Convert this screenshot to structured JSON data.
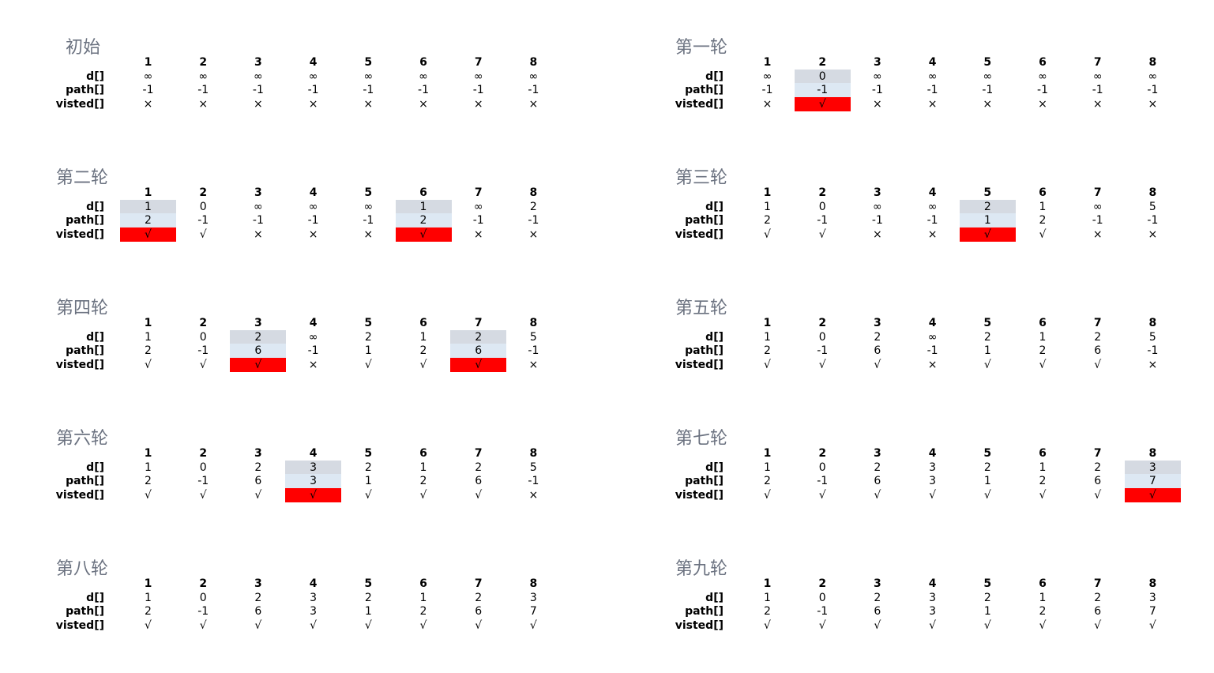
{
  "row_labels": [
    "d[]",
    "path[]",
    "visted[]"
  ],
  "columns": [
    "1",
    "2",
    "3",
    "4",
    "5",
    "6",
    "7",
    "8"
  ],
  "colors": {
    "title": "#6b7280",
    "highlight_d": "#d5dae2",
    "highlight_path": "#dde8f3",
    "highlight_visited": "#ff0000"
  },
  "panels": [
    {
      "title": "初始",
      "d": [
        "∞",
        "∞",
        "∞",
        "∞",
        "∞",
        "∞",
        "∞",
        "∞"
      ],
      "path": [
        "-1",
        "-1",
        "-1",
        "-1",
        "-1",
        "-1",
        "-1",
        "-1"
      ],
      "visited": [
        "×",
        "×",
        "×",
        "×",
        "×",
        "×",
        "×",
        "×"
      ],
      "highlight": []
    },
    {
      "title": "第一轮",
      "d": [
        "∞",
        "0",
        "∞",
        "∞",
        "∞",
        "∞",
        "∞",
        "∞"
      ],
      "path": [
        "-1",
        "-1",
        "-1",
        "-1",
        "-1",
        "-1",
        "-1",
        "-1"
      ],
      "visited": [
        "×",
        "√",
        "×",
        "×",
        "×",
        "×",
        "×",
        "×"
      ],
      "highlight": [
        2
      ]
    },
    {
      "title": "第二轮",
      "d": [
        "1",
        "0",
        "∞",
        "∞",
        "∞",
        "1",
        "∞",
        "2"
      ],
      "path": [
        "2",
        "-1",
        "-1",
        "-1",
        "-1",
        "2",
        "-1",
        "-1"
      ],
      "visited": [
        "√",
        "√",
        "×",
        "×",
        "×",
        "√",
        "×",
        "×"
      ],
      "highlight": [
        1,
        6
      ]
    },
    {
      "title": "第三轮",
      "d": [
        "1",
        "0",
        "∞",
        "∞",
        "2",
        "1",
        "∞",
        "5"
      ],
      "path": [
        "2",
        "-1",
        "-1",
        "-1",
        "1",
        "2",
        "-1",
        "-1"
      ],
      "visited": [
        "√",
        "√",
        "×",
        "×",
        "√",
        "√",
        "×",
        "×"
      ],
      "highlight": [
        5
      ]
    },
    {
      "title": "第四轮",
      "d": [
        "1",
        "0",
        "2",
        "∞",
        "2",
        "1",
        "2",
        "5"
      ],
      "path": [
        "2",
        "-1",
        "6",
        "-1",
        "1",
        "2",
        "6",
        "-1"
      ],
      "visited": [
        "√",
        "√",
        "√",
        "×",
        "√",
        "√",
        "√",
        "×"
      ],
      "highlight": [
        3,
        7
      ]
    },
    {
      "title": "第五轮",
      "d": [
        "1",
        "0",
        "2",
        "∞",
        "2",
        "1",
        "2",
        "5"
      ],
      "path": [
        "2",
        "-1",
        "6",
        "-1",
        "1",
        "2",
        "6",
        "-1"
      ],
      "visited": [
        "√",
        "√",
        "√",
        "×",
        "√",
        "√",
        "√",
        "×"
      ],
      "highlight": []
    },
    {
      "title": "第六轮",
      "d": [
        "1",
        "0",
        "2",
        "3",
        "2",
        "1",
        "2",
        "5"
      ],
      "path": [
        "2",
        "-1",
        "6",
        "3",
        "1",
        "2",
        "6",
        "-1"
      ],
      "visited": [
        "√",
        "√",
        "√",
        "√",
        "√",
        "√",
        "√",
        "×"
      ],
      "highlight": [
        4
      ]
    },
    {
      "title": "第七轮",
      "d": [
        "1",
        "0",
        "2",
        "3",
        "2",
        "1",
        "2",
        "3"
      ],
      "path": [
        "2",
        "-1",
        "6",
        "3",
        "1",
        "2",
        "6",
        "7"
      ],
      "visited": [
        "√",
        "√",
        "√",
        "√",
        "√",
        "√",
        "√",
        "√"
      ],
      "highlight": [
        8
      ]
    },
    {
      "title": "第八轮",
      "d": [
        "1",
        "0",
        "2",
        "3",
        "2",
        "1",
        "2",
        "3"
      ],
      "path": [
        "2",
        "-1",
        "6",
        "3",
        "1",
        "2",
        "6",
        "7"
      ],
      "visited": [
        "√",
        "√",
        "√",
        "√",
        "√",
        "√",
        "√",
        "√"
      ],
      "highlight": []
    },
    {
      "title": "第九轮",
      "d": [
        "1",
        "0",
        "2",
        "3",
        "2",
        "1",
        "2",
        "3"
      ],
      "path": [
        "2",
        "-1",
        "6",
        "3",
        "1",
        "2",
        "6",
        "7"
      ],
      "visited": [
        "√",
        "√",
        "√",
        "√",
        "√",
        "√",
        "√",
        "√"
      ],
      "highlight": []
    }
  ]
}
